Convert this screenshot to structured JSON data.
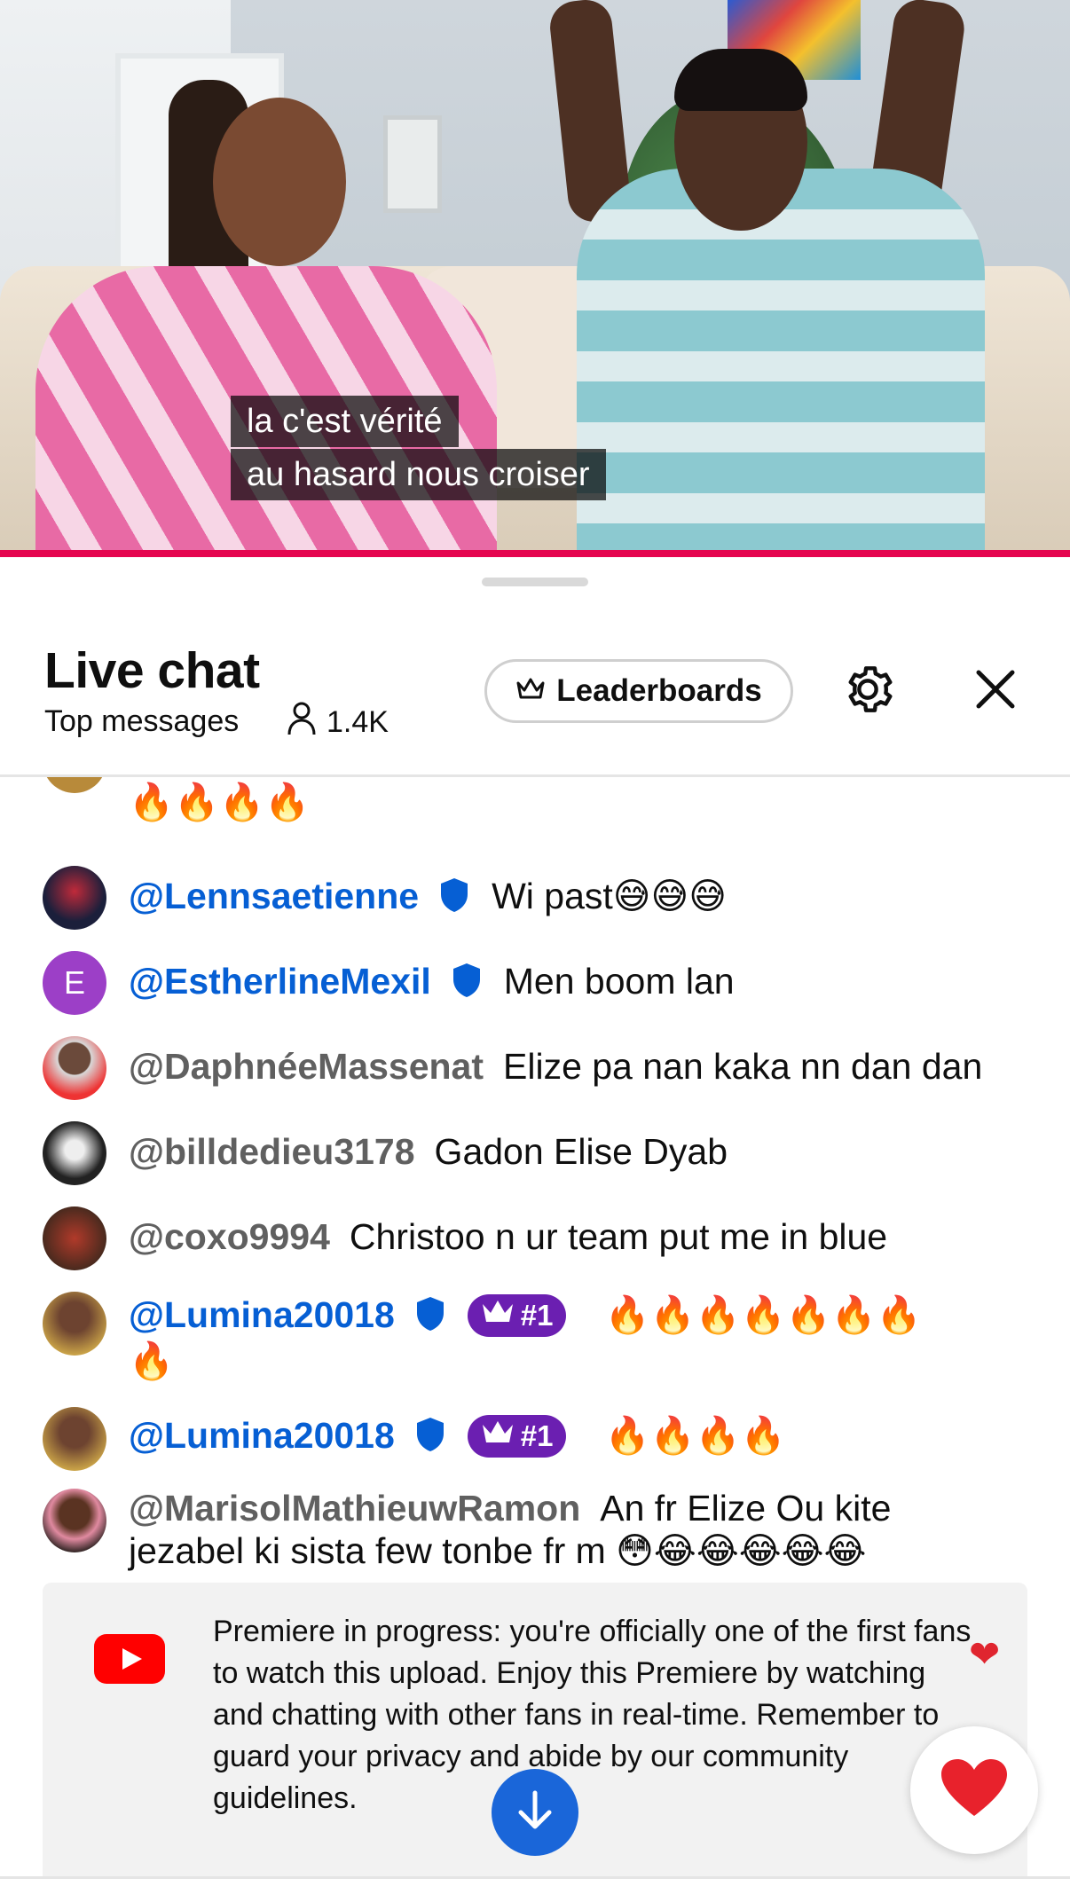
{
  "video": {
    "caption_line1": "la c'est vérité",
    "caption_line2": "au hasard nous croiser",
    "progress_color": "#e5054f"
  },
  "chat_header": {
    "title": "Live chat",
    "mode": "Top messages",
    "viewer_count": "1.4K",
    "leaderboards_label": "Leaderboards",
    "settings_icon": "gear-icon",
    "close_icon": "close-icon"
  },
  "messages": [
    {
      "author": "",
      "text": "🔥🔥🔥🔥",
      "partial": true
    },
    {
      "author": "@Lennsaetienne",
      "member": true,
      "verified": true,
      "text": "Wi past😅😅😅"
    },
    {
      "author": "@EstherlineMexil",
      "member": true,
      "verified": true,
      "avatar_letter": "E",
      "text": "Men boom lan"
    },
    {
      "author": "@DaphnéeMassenat",
      "member": false,
      "text": "Elize pa nan kaka nn dan dan"
    },
    {
      "author": "@billdedieu3178",
      "member": false,
      "text": "Gadon Elise Dyab"
    },
    {
      "author": "@coxo9994",
      "member": false,
      "text": "Christoo n ur team put me in blue"
    },
    {
      "author": "@Lumina20018",
      "member": true,
      "verified": true,
      "rank": "#1",
      "text": "🔥🔥🔥🔥🔥🔥🔥",
      "text2": "🔥"
    },
    {
      "author": "@Lumina20018",
      "member": true,
      "verified": true,
      "rank": "#1",
      "text": "🔥🔥🔥🔥"
    },
    {
      "author": "@MarisolMathieuwRamon",
      "member": false,
      "text": "An fr Elize Ou kite",
      "text2": "jezabel ki sista few tonbe fr m 😳😂😂😂😂😂"
    }
  ],
  "notice": {
    "text": "Premiere in progress: you're officially one of the first fans to watch this upload. Enjoy this Premiere by watching and chatting with other fans in real-time. Remember to guard your privacy and abide by our community guidelines."
  },
  "colors": {
    "member_blue": "#065fd4",
    "rank_purple": "#6b1fb1",
    "jump_blue": "#1a66d9",
    "youtube_red": "#ff0000"
  }
}
